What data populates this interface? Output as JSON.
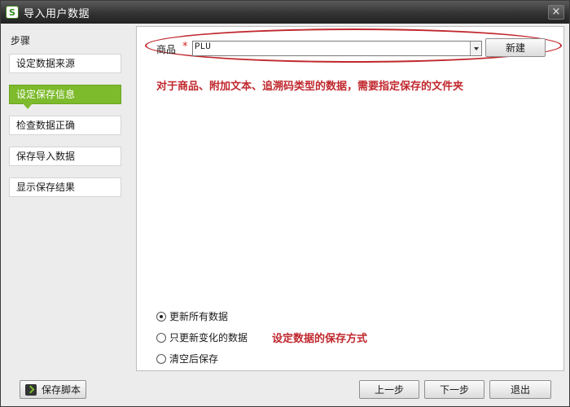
{
  "window": {
    "title": "导入用户数据",
    "app_icon": "S"
  },
  "sidebar": {
    "title": "步骤",
    "steps": [
      {
        "label": "设定数据来源"
      },
      {
        "label": "设定保存信息",
        "active": true
      },
      {
        "label": "检查数据正确"
      },
      {
        "label": "保存导入数据"
      },
      {
        "label": "显示保存结果"
      }
    ]
  },
  "form": {
    "field_label": "商品",
    "required_mark": "*",
    "select_value": "PLU",
    "new_button": "新建"
  },
  "annotations": {
    "folder_note": "对于商品、附加文本、追溯码类型的数据，需要指定保存的文件夹",
    "save_mode_note": "设定数据的保存方式"
  },
  "save_options": [
    {
      "label": "更新所有数据",
      "checked": true
    },
    {
      "label": "只更新变化的数据",
      "checked": false
    },
    {
      "label": "清空后保存",
      "checked": false
    }
  ],
  "footer": {
    "save_script": "保存脚本",
    "prev": "上一步",
    "next": "下一步",
    "exit": "退出"
  },
  "colors": {
    "accent_green": "#7dbb2c",
    "annotation_red": "#c0282e"
  }
}
